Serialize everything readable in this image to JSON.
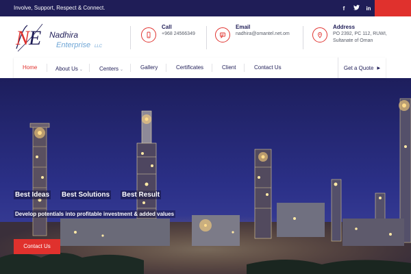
{
  "topbar": {
    "tagline": "Involve, Support, Respect & Connect.",
    "social": [
      {
        "icon": "facebook-icon",
        "glyph": "f"
      },
      {
        "icon": "twitter-icon",
        "glyph": "t"
      },
      {
        "icon": "linkedin-icon",
        "glyph": "in"
      }
    ]
  },
  "logo": {
    "initials": "NE",
    "line1": "Nadhira",
    "line2": "Enterprise",
    "suffix": "LLC"
  },
  "contact": {
    "call": {
      "title": "Call",
      "value": "+968 24566349"
    },
    "email": {
      "title": "Email",
      "value": "nadhira@omantel.net.om"
    },
    "address": {
      "title": "Address",
      "line1": "PO 2392, PC 112, RUWI,",
      "line2": "Sultanate of Oman"
    }
  },
  "nav": {
    "items": [
      "Home",
      "About Us",
      "Centers",
      "Gallery",
      "Certificates",
      "Client",
      "Contact Us"
    ],
    "quote": "Get a Quote"
  },
  "hero": {
    "tags": [
      "Best Ideas",
      "Best Solutions",
      "Best Result"
    ],
    "subtitle": "Develop potentials into profitable investment & added values",
    "button": "Contact Us"
  },
  "colors": {
    "navy": "#1f1d57",
    "red": "#e0312d"
  }
}
